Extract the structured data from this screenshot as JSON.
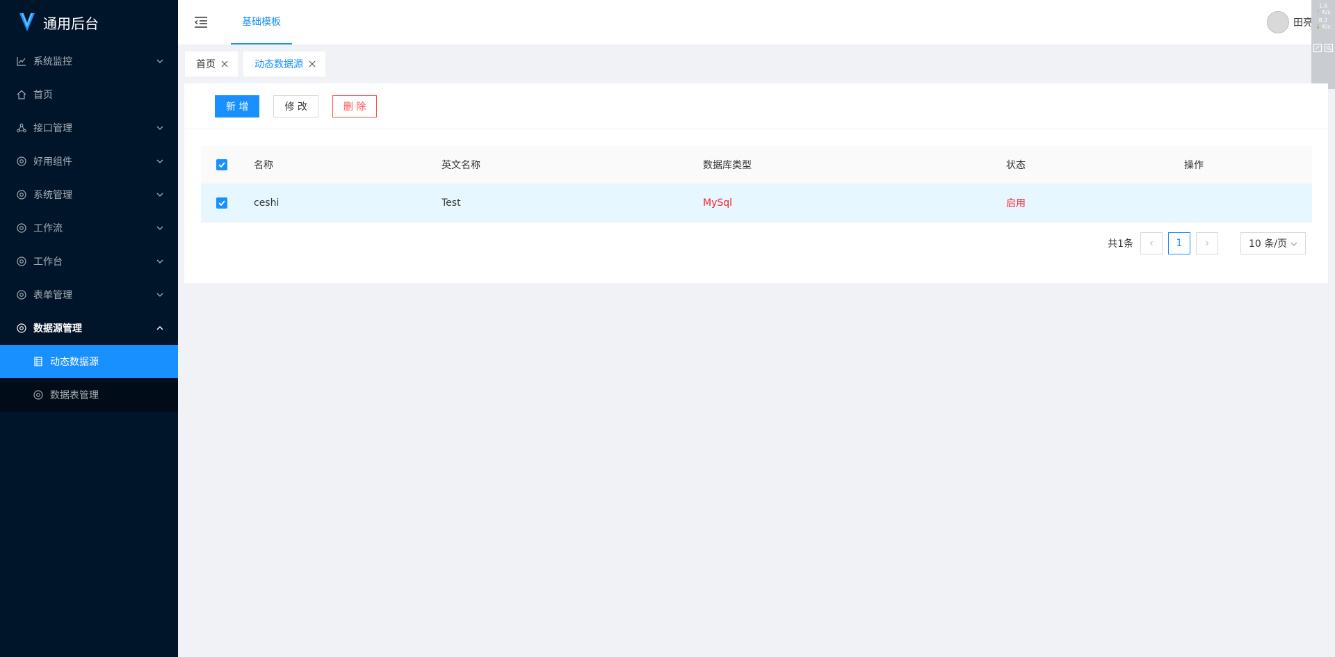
{
  "app": {
    "title": "通用后台",
    "colors": {
      "sidebar_bg": "#001529",
      "primary": "#1890ff",
      "danger": "#ff4d4f",
      "red_text": "#f5222d"
    }
  },
  "sidebar": {
    "items": [
      {
        "label": "系统监控",
        "icon": "line-chart-icon",
        "expandable": true
      },
      {
        "label": "首页",
        "icon": "home-icon",
        "expandable": false
      },
      {
        "label": "接口管理",
        "icon": "api-icon",
        "expandable": true
      },
      {
        "label": "好用组件",
        "icon": "chrome-icon",
        "expandable": true
      },
      {
        "label": "系统管理",
        "icon": "chrome-icon",
        "expandable": true
      },
      {
        "label": "工作流",
        "icon": "chrome-icon",
        "expandable": true
      },
      {
        "label": "工作台",
        "icon": "chrome-icon",
        "expandable": true
      },
      {
        "label": "表单管理",
        "icon": "chrome-icon",
        "expandable": true
      },
      {
        "label": "数据源管理",
        "icon": "chrome-icon",
        "expandable": true,
        "open": true
      }
    ],
    "submenu": [
      {
        "label": "动态数据源",
        "icon": "table-icon",
        "active": true
      },
      {
        "label": "数据表管理",
        "icon": "chrome-icon",
        "active": false
      }
    ]
  },
  "header": {
    "tab_label": "基础模板",
    "username": "田亮"
  },
  "speed_widget": {
    "up_value": "1.6",
    "up_unit": "K/s",
    "down_value": "8.2",
    "down_unit": "K/s"
  },
  "page_tabs": [
    {
      "label": "首页",
      "active": false
    },
    {
      "label": "动态数据源",
      "active": true
    }
  ],
  "toolbar": {
    "add_label": "新 增",
    "edit_label": "修 改",
    "delete_label": "删 除"
  },
  "table": {
    "columns": [
      "名称",
      "英文名称",
      "数据库类型",
      "状态",
      "操作"
    ],
    "rows": [
      {
        "name": "ceshi",
        "english_name": "Test",
        "db_type": "MySql",
        "status": "启用",
        "selected": true
      }
    ],
    "header_checked": true
  },
  "pagination": {
    "total_text": "共1条",
    "current_page": "1",
    "page_size": "10 条/页"
  }
}
